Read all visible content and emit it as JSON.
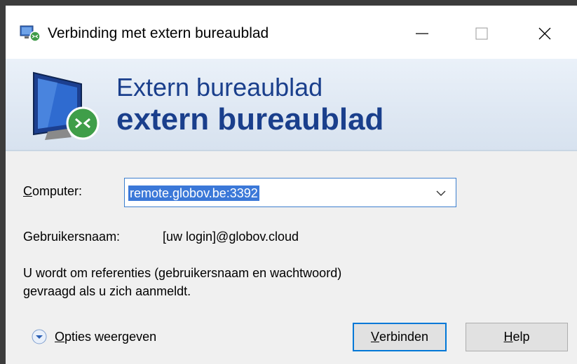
{
  "window": {
    "title": "Verbinding met extern bureaublad",
    "minimize_glyph": "—",
    "maximize_glyph": "☐",
    "close_glyph": "✕",
    "app_icon": "remote-desktop-icon"
  },
  "banner": {
    "line1": "Extern bureaublad",
    "line2": "extern bureaublad",
    "text_color": "#1a3f8c",
    "icon": "monitor-remote-icon"
  },
  "form": {
    "computer_label_accesskey": "C",
    "computer_label_rest": "omputer:",
    "computer_value": "remote.globov.be:3392",
    "username_label": "Gebruikersnaam:",
    "username_value": "[uw login]@globov.cloud",
    "info_line1": "U wordt om referenties (gebruikersnaam en wachtwoord)",
    "info_line2": "gevraagd als u zich aanmeldt."
  },
  "footer": {
    "options_accesskey": "O",
    "options_rest": "pties weergeven",
    "connect_accesskey": "V",
    "connect_rest": "erbinden",
    "help_accesskey": "H",
    "help_rest": "elp"
  },
  "colors": {
    "selection": "#3b78d8",
    "accent_border": "#0078d7"
  }
}
